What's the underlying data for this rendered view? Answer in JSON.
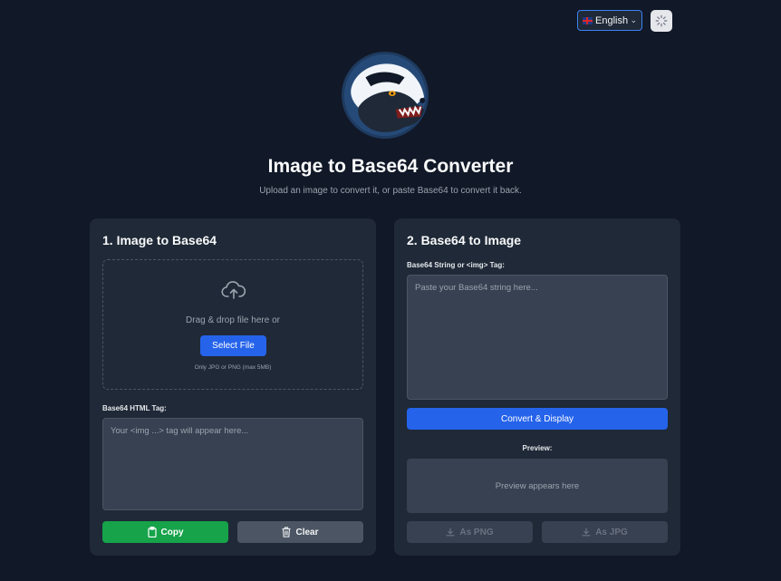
{
  "header": {
    "language": "English",
    "language_flag": "uk-flag-icon",
    "theme_icon": "loader-icon"
  },
  "hero": {
    "logo_icon": "honey-badger-logo",
    "title": "Image to Base64 Converter",
    "subtitle": "Upload an image to convert it, or paste Base64 to convert it back."
  },
  "left_panel": {
    "title": "1. Image to Base64",
    "drop_text": "Drag & drop file here or",
    "select_button": "Select File",
    "hint": "Only JPG or PNG (max 5MB)",
    "output_label": "Base64 HTML Tag:",
    "output_placeholder": "Your <img ...> tag will appear here...",
    "copy_button": "Copy",
    "clear_button": "Clear"
  },
  "right_panel": {
    "title": "2. Base64 to Image",
    "input_label": "Base64 String or <img> Tag:",
    "input_placeholder": "Paste your Base64 string here...",
    "convert_button": "Convert & Display",
    "preview_label": "Preview:",
    "preview_placeholder": "Preview appears here",
    "png_button": "As PNG",
    "jpg_button": "As JPG"
  },
  "colors": {
    "background": "#111827",
    "card": "#1f2937",
    "primary": "#2563eb",
    "success": "#16a34a"
  }
}
